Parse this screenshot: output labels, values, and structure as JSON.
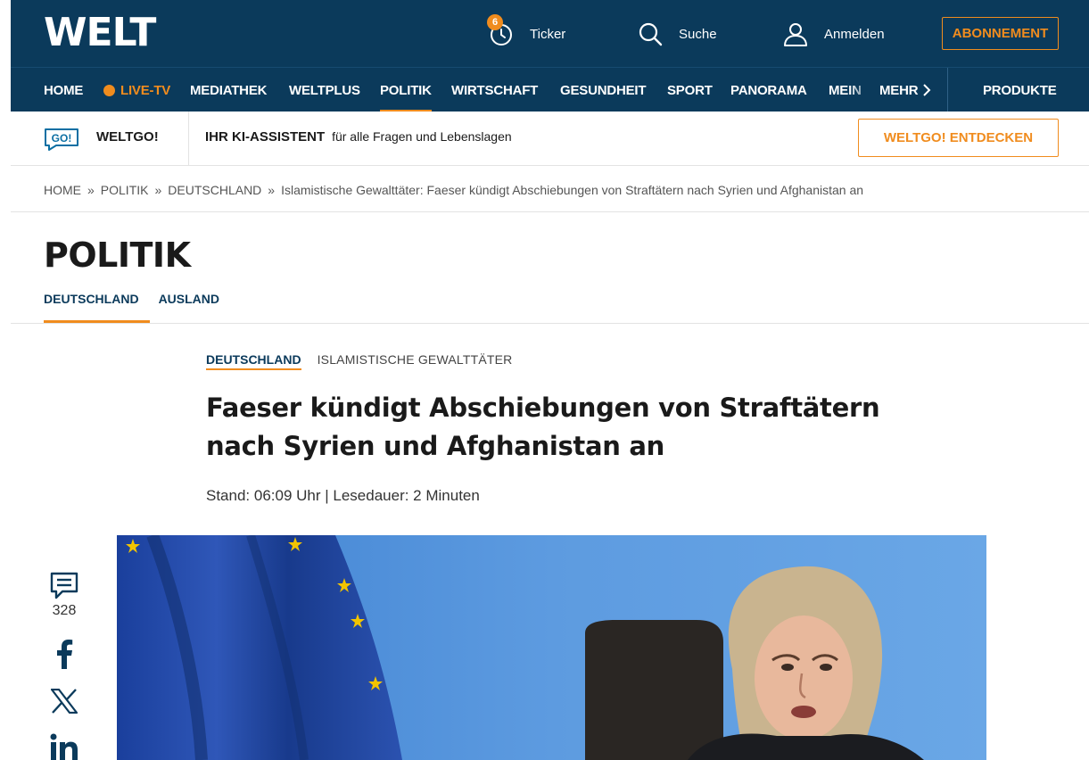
{
  "header": {
    "logo": "WELT",
    "ticker_label": "Ticker",
    "ticker_badge": "6",
    "search_label": "Suche",
    "login_label": "Anmelden",
    "subscribe_label": "ABONNEMENT"
  },
  "nav": {
    "items": [
      "HOME",
      "LIVE-TV",
      "MEDIATHEK",
      "WELTPLUS",
      "POLITIK",
      "WIRTSCHAFT",
      "GESUNDHEIT",
      "SPORT",
      "PANORAMA",
      "MEIN"
    ],
    "more_label": "MEHR",
    "products_label": "PRODUKTE",
    "active": "POLITIK"
  },
  "weltgo": {
    "icon_text": "GO!",
    "brand": "WELTGO!",
    "ki_title": "IHR KI-ASSISTENT",
    "ki_text": "für alle Fragen und Lebenslagen",
    "cta": "WELTGO! ENTDECKEN"
  },
  "breadcrumb": {
    "items": [
      "HOME",
      "POLITIK",
      "DEUTSCHLAND",
      "Islamistische Gewalttäter: Faeser kündigt Abschiebungen von Straftätern nach Syrien und Afghanistan an"
    ],
    "separator": "»"
  },
  "section": {
    "title": "POLITIK",
    "subnav": [
      "DEUTSCHLAND",
      "AUSLAND"
    ]
  },
  "article": {
    "kicker_primary": "DEUTSCHLAND",
    "kicker_secondary": "ISLAMISTISCHE GEWALTTÄTER",
    "headline_line1": "Faeser kündigt Abschiebungen von Straftätern",
    "headline_line2": "nach Syrien und Afghanistan an",
    "meta": "Stand: 06:09 Uhr | Lesedauer: 2 Minuten"
  },
  "social": {
    "comments_count": "328"
  },
  "colors": {
    "brand_navy": "#0b3a5b",
    "accent_orange": "#f08c1e"
  }
}
